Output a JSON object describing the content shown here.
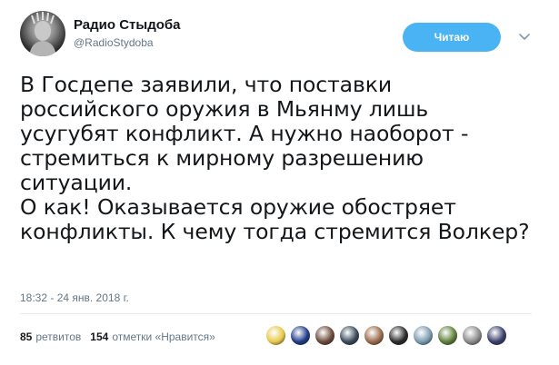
{
  "tweet": {
    "author": {
      "display_name": "Радио Стыдоба",
      "handle": "@RadioStydoba"
    },
    "follow_button": "Читаю",
    "text_lines": [
      "В Госдепе заявили, что поставки",
      "российского оружия в Мьянму лишь",
      "усугубят конфликт. А нужно наоборот -",
      "стремиться к мирному разрешению",
      "ситуации.",
      "О как! Оказывается оружие обостряет",
      "конфликты. К чему тогда стремится Волкер?"
    ],
    "timestamp": "18:32 - 24 янв. 2018 г.",
    "stats": {
      "retweets_count": "85",
      "retweets_label": "ретвитов",
      "likes_count": "154",
      "likes_label": "отметки «Нравится»"
    },
    "liker_avatar_colors": [
      "#e8c94a",
      "#1f3c88",
      "#6b4b3a",
      "#3a4a5a",
      "#9a6a4a",
      "#2b2b2b",
      "#7a9ab0",
      "#5f7f3a",
      "#8a8a8a",
      "#3b3f6b"
    ]
  },
  "colors": {
    "accent": "#4ab3f4",
    "secondary_text": "#657786",
    "primary_text": "#14171a"
  }
}
